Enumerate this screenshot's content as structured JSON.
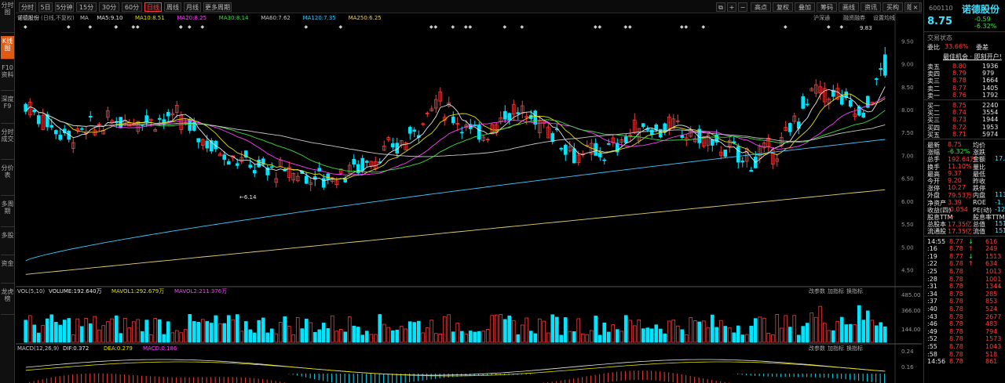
{
  "left_tabs": [
    "分时图",
    "K线图",
    "F10资料",
    "深度F9",
    "分时成交",
    "分价表",
    "多周期",
    "多股",
    "资金",
    "龙虎榜"
  ],
  "toolbar": {
    "periods": [
      "分时",
      "5日",
      "5分钟",
      "15分钟",
      "30分钟",
      "60分钟",
      "日线",
      "周线",
      "月线",
      "更多周期"
    ],
    "active_period": "日线",
    "right_buttons": [
      "高点",
      "复权",
      "叠加",
      "筹码",
      "画线",
      "资讯",
      "买构",
      "隐藏"
    ]
  },
  "chart": {
    "title": "诺德股份",
    "subtitle": "(日线,不复权)",
    "ma_legend": [
      {
        "label": "MA",
        "value": "",
        "color": "#c8c8c8"
      },
      {
        "label": "MA5:",
        "value": "9.10",
        "color": "#e6e6e6"
      },
      {
        "label": "MA10:",
        "value": "8.51",
        "color": "#e0e000"
      },
      {
        "label": "MA20:",
        "value": "8.25",
        "color": "#ff40ff"
      },
      {
        "label": "MA30:",
        "value": "8.14",
        "color": "#3be03b"
      },
      {
        "label": "MA60:",
        "value": "7.62",
        "color": "#c8c8c8"
      },
      {
        "label": "MA120:",
        "value": "7.35",
        "color": "#3fc8ff"
      },
      {
        "label": "MA250:",
        "value": "6.25",
        "color": "#e8d070"
      }
    ],
    "top_links": [
      "沪深通",
      "融资融券",
      "设置均线"
    ],
    "price_axis": [
      "9.50",
      "9.00",
      "8.50",
      "8.00",
      "7.50",
      "7.00",
      "6.50",
      "6.00",
      "5.50",
      "5.00",
      "4.50"
    ],
    "y_range": [
      4.2,
      9.9
    ],
    "high_label": "9.83",
    "low_label": "6.14",
    "vol": {
      "legend": [
        {
          "text": "VOL(5,10)",
          "color": "#c8c8c8"
        },
        {
          "text": "VOLUME:192.640万",
          "color": "#e6e6e6"
        },
        {
          "text": "MAVOL1:292.679万",
          "color": "#e0e000"
        },
        {
          "text": "MAVOL2:211.376万",
          "color": "#ff40ff"
        }
      ],
      "axis": [
        "485.00",
        "366.00",
        "144.00"
      ],
      "tools": [
        "改参数",
        "加指标",
        "换指标"
      ]
    },
    "macd": {
      "legend": [
        {
          "text": "MACD(12,26,9)",
          "color": "#c8c8c8"
        },
        {
          "text": "DIF:0.372",
          "color": "#e6e6e6"
        },
        {
          "text": "DEA:0.279",
          "color": "#e0e000"
        },
        {
          "text": "MACD:0.186",
          "color": "#ff40ff"
        }
      ],
      "axis": [
        "0.24",
        "0.16"
      ],
      "tools": [
        "改参数",
        "加指标",
        "换指标"
      ]
    }
  },
  "quote": {
    "code": "600110",
    "name": "诺德股份",
    "price": "8.75",
    "change": "-0.59",
    "pct": "-6.32%",
    "section": "交易状态",
    "wb_label": "委比",
    "wb": "33.66%",
    "wc_label": "委差",
    "ad": "最佳机会 · 即刻开户!",
    "asks": [
      [
        "卖五",
        "8.80",
        "1936"
      ],
      [
        "卖四",
        "8.79",
        "979"
      ],
      [
        "卖三",
        "8.78",
        "1664"
      ],
      [
        "卖二",
        "8.77",
        "1405"
      ],
      [
        "卖一",
        "8.76",
        "1792"
      ]
    ],
    "bids": [
      [
        "买一",
        "8.75",
        "2240"
      ],
      [
        "买二",
        "8.74",
        "3554"
      ],
      [
        "买三",
        "8.73",
        "1944"
      ],
      [
        "买四",
        "8.72",
        "1953"
      ],
      [
        "买五",
        "8.71",
        "5974"
      ]
    ],
    "stats": [
      [
        "最新",
        "8.75",
        "均价",
        ""
      ],
      [
        "涨幅",
        "-6.32%",
        "涨跌",
        ""
      ],
      [
        "总手",
        "192.64万",
        "金额",
        "17."
      ],
      [
        "换手",
        "11.10%",
        "量比",
        ""
      ],
      [
        "最高",
        "9.37",
        "最低",
        ""
      ],
      [
        "今开",
        "9.20",
        "昨收",
        ""
      ],
      [
        "涨停",
        "10.27",
        "跌停",
        ""
      ],
      [
        "外盘",
        "79.53万",
        "内盘",
        "113."
      ],
      [
        "净资产",
        "3.39",
        "ROE",
        "-1."
      ],
      [
        "收益(四)",
        "-0.054",
        "PE(动)",
        "-12"
      ],
      [
        "股息TTM",
        "—",
        "股息率TTM",
        ""
      ],
      [
        "总股本",
        "17.35亿",
        "总值",
        "151"
      ],
      [
        "流通股",
        "17.35亿",
        "流值",
        "151"
      ]
    ],
    "ticks": [
      [
        "14:55",
        "8.77",
        "↓",
        "616"
      ],
      [
        ":16",
        "8.78",
        "↑",
        "249"
      ],
      [
        ":19",
        "8.77",
        "↓",
        "1513"
      ],
      [
        ":22",
        "8.78",
        "↑",
        "634"
      ],
      [
        ":25",
        "8.78",
        "",
        "1013"
      ],
      [
        ":28",
        "8.78",
        "",
        "1001"
      ],
      [
        ":31",
        "8.78",
        "",
        "1344"
      ],
      [
        ":34",
        "8.78",
        "",
        "285"
      ],
      [
        ":37",
        "8.78",
        "",
        "853"
      ],
      [
        ":40",
        "8.78",
        "",
        "524"
      ],
      [
        ":43",
        "8.78",
        "",
        "2677"
      ],
      [
        ":46",
        "8.78",
        "",
        "483"
      ],
      [
        ":49",
        "8.78",
        "",
        "794"
      ],
      [
        ":52",
        "8.78",
        "",
        "1573"
      ],
      [
        ":55",
        "8.78",
        "",
        "1043"
      ],
      [
        ":58",
        "8.78",
        "",
        "518"
      ],
      [
        "14:56",
        "8.78",
        "",
        "861"
      ]
    ]
  },
  "colors": {
    "up": "#ff3b3b",
    "down": "#00e5ff",
    "bg": "#000000",
    "accent": "#e05a14"
  }
}
